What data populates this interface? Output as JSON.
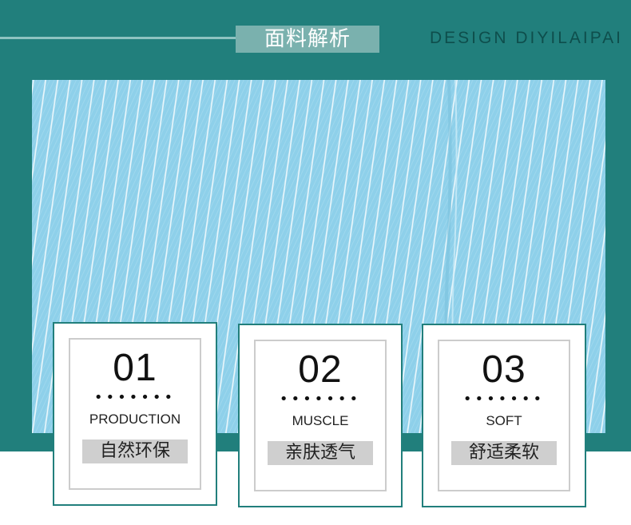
{
  "header": {
    "title": "面料解析",
    "subtitle": "DESIGN DIYILAIPAI"
  },
  "colors": {
    "teal": "#217f7c",
    "fabric_blue": "#8ed0ea",
    "label_gray": "#cfcfcf"
  },
  "features": [
    {
      "number": "01",
      "dots": "•••••••",
      "english": "PRODUCTION",
      "chinese": "自然环保"
    },
    {
      "number": "02",
      "dots": "•••••••",
      "english": "MUSCLE",
      "chinese": "亲肤透气"
    },
    {
      "number": "03",
      "dots": "•••••••",
      "english": "SOFT",
      "chinese": "舒适柔软"
    }
  ]
}
